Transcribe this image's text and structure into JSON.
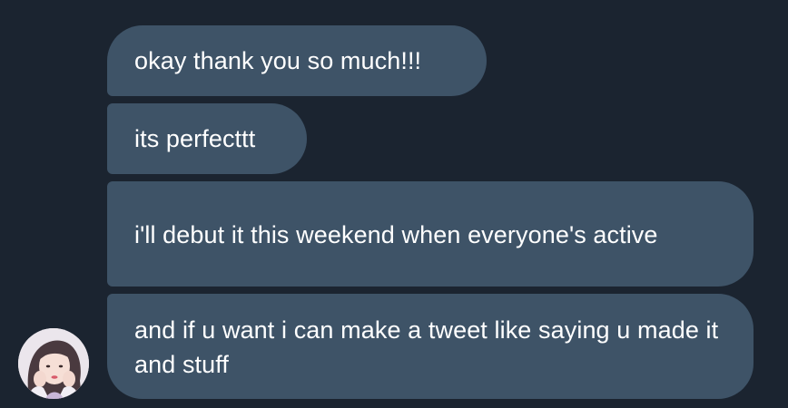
{
  "conversation": {
    "messages": [
      {
        "text": "okay thank you so much!!!"
      },
      {
        "text": "its perfecttt"
      },
      {
        "text": "i'll debut it this weekend when everyone's active"
      },
      {
        "text": "and if u want i can make a tweet like saying u made it and stuff"
      }
    ],
    "avatar_icon": "user-avatar-photo"
  },
  "colors": {
    "background": "#1b2430",
    "bubble": "#3e5367",
    "text": "#ffffff"
  }
}
